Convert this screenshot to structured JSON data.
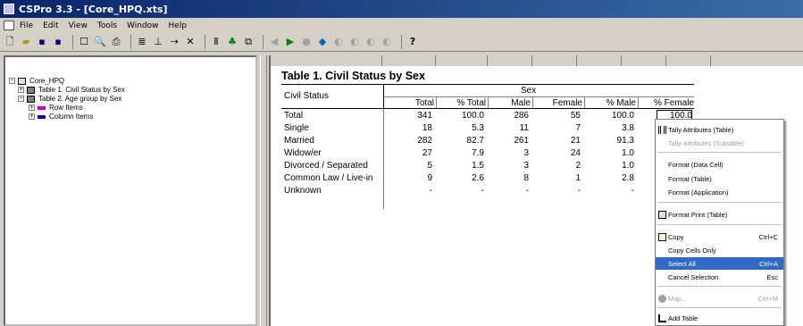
{
  "window": {
    "title": "CSPro 3.3 - [Core_HPQ.xts]"
  },
  "menu": [
    "File",
    "Edit",
    "View",
    "Tools",
    "Window",
    "Help"
  ],
  "toolbar_icons": [
    "new-icon",
    "open-icon",
    "save-icon",
    "save-all-icon",
    "view-icon",
    "print-preview-icon",
    "print-icon",
    "tree-icon",
    "add-table-icon",
    "run-icon",
    "delete-icon",
    "tally-icon",
    "area-icon",
    "copy-icon",
    "back-icon",
    "forward-icon",
    "stop-icon",
    "map-icon",
    "chart1-icon",
    "chart2-icon",
    "chart3-icon",
    "chart4-icon",
    "help-icon"
  ],
  "tree": {
    "root": "Core_HPQ",
    "table1": "Table 1. Civil Status by Sex",
    "table2": "Table 2. Age group by Sex",
    "row_items": "Row Items",
    "column_items": "Column Items"
  },
  "table": {
    "title": "Table 1. Civil Status by Sex",
    "stub_header": "Civil Status",
    "spanner": "Sex",
    "columns": [
      "Total",
      "% Total",
      "Male",
      "Female",
      "% Male",
      "% Female"
    ],
    "rows": [
      {
        "label": "Total",
        "values": [
          "341",
          "100.0",
          "286",
          "55",
          "100.0",
          "100.0"
        ]
      },
      {
        "label": "Single",
        "values": [
          "18",
          "5.3",
          "11",
          "7",
          "3.8",
          ""
        ]
      },
      {
        "label": "Married",
        "values": [
          "282",
          "82.7",
          "261",
          "21",
          "91.3",
          ""
        ]
      },
      {
        "label": "Widow/er",
        "values": [
          "27",
          "7.9",
          "3",
          "24",
          "1.0",
          ""
        ]
      },
      {
        "label": "Divorced / Separated",
        "values": [
          "5",
          "1.5",
          "3",
          "2",
          "1.0",
          ""
        ]
      },
      {
        "label": "Common Law / Live-in",
        "values": [
          "9",
          "2.6",
          "8",
          "1",
          "2.8",
          ""
        ]
      },
      {
        "label": "Unknown",
        "values": [
          "-",
          "-",
          "-",
          "-",
          "-",
          ""
        ]
      }
    ]
  },
  "context_menu": {
    "tally_table": "Tally Attributes (Table)",
    "tally_subtable": "Tally Attributes (Subtable)",
    "format_data_cell": "Format (Data Cell)",
    "format_table": "Format (Table)",
    "format_application": "Format (Application)",
    "format_print": "Format Print (Table)",
    "copy": "Copy",
    "copy_sc": "Ctrl+C",
    "copy_cells_only": "Copy Cells Only",
    "select_all": "Select All",
    "select_all_sc": "Ctrl+A",
    "cancel_selection": "Cancel Selection",
    "cancel_sc": "Esc",
    "map": "Map...",
    "map_sc": "Ctrl+M",
    "add_table": "Add Table"
  },
  "colors": {
    "title_bar": "#0a246a",
    "selection": "#316ac5",
    "row_items_icon": "#c000c0",
    "column_items_icon": "#0000c0"
  }
}
